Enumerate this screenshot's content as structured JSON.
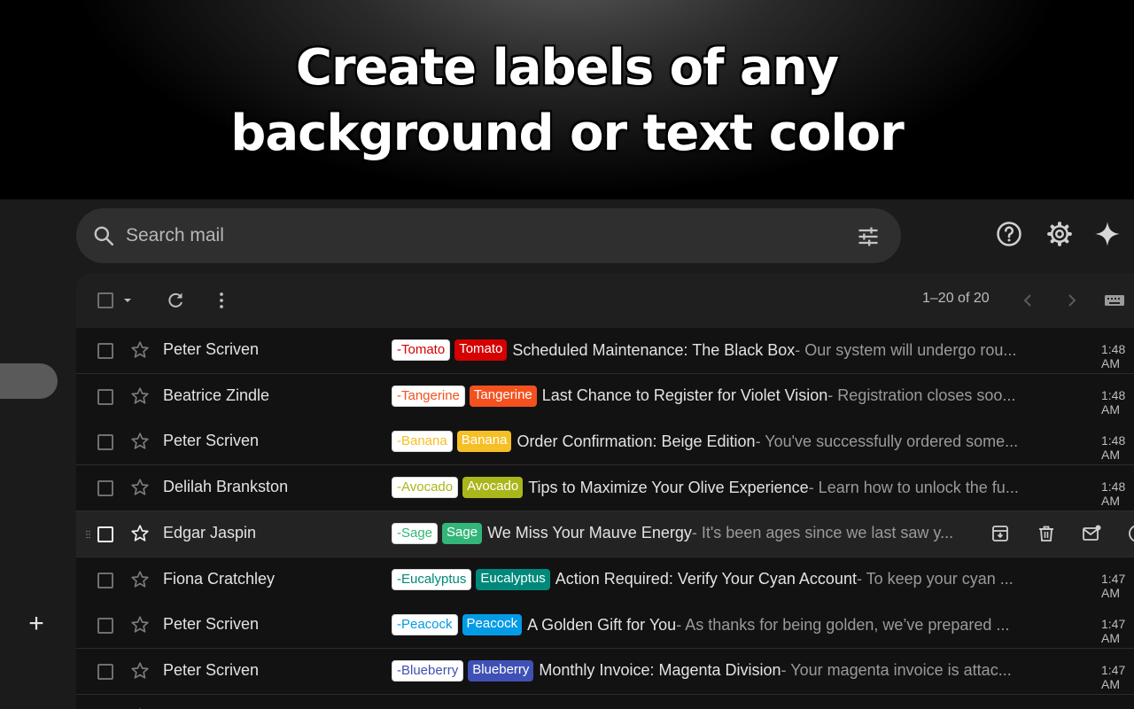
{
  "hero": {
    "line1": "Create labels of any",
    "line2": "background or text color"
  },
  "search": {
    "placeholder": "Search mail"
  },
  "toolbar": {
    "range": "1–20 of 20"
  },
  "icons": {
    "search": "search-icon",
    "tune": "tune-icon",
    "help": "help-icon",
    "settings": "gear-icon",
    "gemini": "sparkle-icon",
    "refresh": "refresh-icon",
    "more": "more-vert-icon",
    "prev": "chevron-left-icon",
    "next": "chevron-right-icon",
    "keyboard": "keyboard-icon",
    "archive": "archive-icon",
    "delete": "trash-icon",
    "mark_unread": "mark-unread-icon",
    "snooze": "snooze-icon",
    "compose": "plus-icon"
  },
  "emails": [
    {
      "sender": "Peter Scriven",
      "label_outline": "-Tomato",
      "label_solid": "Tomato",
      "color": "#d50000",
      "subject": "Scheduled Maintenance: The Black Box",
      "snippet": " - Our system will undergo rou...",
      "time": "1:48 AM"
    },
    {
      "sender": "Beatrice Zindle",
      "label_outline": "-Tangerine",
      "label_solid": "Tangerine",
      "color": "#f4511e",
      "subject": "Last Chance to Register for Violet Vision",
      "snippet": " - Registration closes soo...",
      "time": "1:48 AM"
    },
    {
      "sender": "Peter Scriven",
      "label_outline": "-Banana",
      "label_solid": "Banana",
      "color": "#f6bf26",
      "subject": "Order Confirmation: Beige Edition",
      "snippet": " - You've successfully ordered some...",
      "time": "1:48 AM"
    },
    {
      "sender": "Delilah Brankston",
      "label_outline": "-Avocado",
      "label_solid": "Avocado",
      "color": "#aab71b",
      "subject": "Tips to Maximize Your Olive Experience",
      "snippet": " - Learn how to unlock the fu...",
      "time": "1:48 AM"
    },
    {
      "sender": "Edgar Jaspin",
      "label_outline": "-Sage",
      "label_solid": "Sage",
      "color": "#33b679",
      "subject": "We Miss Your Mauve Energy",
      "snippet": " - It's been ages since we last saw y...",
      "time": ""
    },
    {
      "sender": "Fiona Cratchley",
      "label_outline": "-Eucalyptus",
      "label_solid": "Eucalyptus",
      "color": "#00897b",
      "subject": "Action Required: Verify Your Cyan Account",
      "snippet": " - To keep your cyan ...",
      "time": "1:47 AM"
    },
    {
      "sender": "Peter Scriven",
      "label_outline": "-Peacock",
      "label_solid": "Peacock",
      "color": "#039be5",
      "subject": "A Golden Gift for You",
      "snippet": " - As thanks for being golden, we’ve prepared ...",
      "time": "1:47 AM"
    },
    {
      "sender": "Peter Scriven",
      "label_outline": "-Blueberry",
      "label_solid": "Blueberry",
      "color": "#3f51b5",
      "subject": "Monthly Invoice: Magenta Division",
      "snippet": " - Your magenta invoice is attac...",
      "time": "1:47 AM"
    },
    {
      "sender": "",
      "label_outline": "",
      "label_solid": "",
      "color": "#8e24aa",
      "subject": "",
      "snippet": "",
      "time": ""
    }
  ]
}
